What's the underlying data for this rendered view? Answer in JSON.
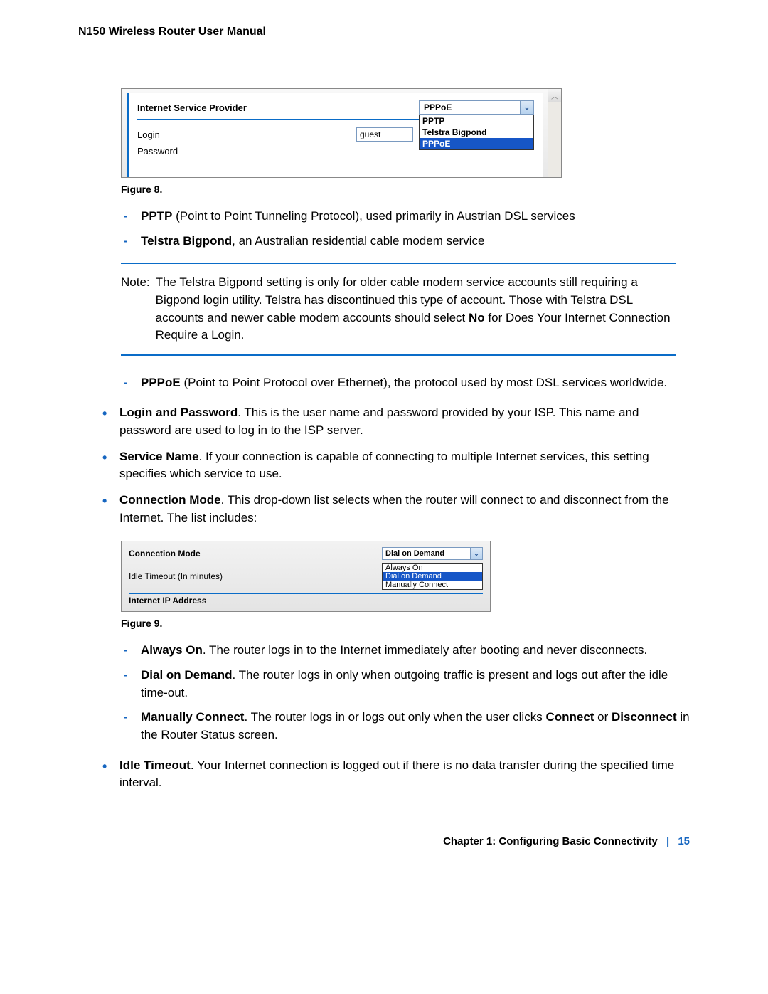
{
  "doc_title": "N150 Wireless Router User Manual",
  "figure8": {
    "isp_label": "Internet Service Provider",
    "login_label": "Login",
    "login_value": "guest",
    "password_label": "Password",
    "select_value": "PPPoE",
    "options": [
      "PPTP",
      "Telstra Bigpond",
      "PPPoE"
    ],
    "selected_index": 2,
    "caption": "Figure 8."
  },
  "list1": {
    "pptp_bold": "PPTP",
    "pptp_rest": " (Point to Point Tunneling Protocol), used primarily in Austrian DSL services",
    "telstra_bold": "Telstra Bigpond",
    "telstra_rest": ", an Australian residential cable modem service"
  },
  "note": {
    "label": "Note:",
    "body_a": "The Telstra Bigpond setting is only for older cable modem service accounts still requiring a Bigpond login utility. Telstra has discontinued this type of account. Those with Telstra DSL accounts and newer cable modem accounts should select ",
    "body_bold": "No",
    "body_b": " for Does Your Internet Connection Require a Login."
  },
  "list2": {
    "pppoe_bold": "PPPoE",
    "pppoe_rest": " (Point to Point Protocol over Ethernet), the protocol used by most DSL services worldwide."
  },
  "bullets1": {
    "b1_bold": "Login and Password",
    "b1_rest": ". This is the user name and password provided by your ISP. This name and password are used to log in to the ISP server.",
    "b2_bold": "Service Name",
    "b2_rest": ". If your connection is capable of connecting to multiple Internet services, this setting specifies which service to use.",
    "b3_bold": "Connection Mode",
    "b3_rest": ". This drop-down list selects when the router will connect to and disconnect from the Internet. The list includes:"
  },
  "figure9": {
    "conn_mode_label": "Connection Mode",
    "idle_label": "Idle Timeout (In minutes)",
    "ip_label": "Internet IP Address",
    "select_value": "Dial on Demand",
    "options": [
      "Always On",
      "Dial on Demand",
      "Manually Connect"
    ],
    "selected_index": 1,
    "caption": "Figure 9."
  },
  "list3": {
    "a_bold": "Always On",
    "a_rest": ". The router logs in to the Internet immediately after booting and never disconnects.",
    "b_bold": "Dial on Demand",
    "b_rest": ". The router logs in only when outgoing traffic is present and logs out after the idle time-out.",
    "c_bold": "Manually Connect",
    "c_rest_a": ". The router logs in or logs out only when the user clicks ",
    "c_connect": "Connect",
    "c_rest_b": " or ",
    "c_disconnect": "Disconnect",
    "c_rest_c": " in the Router Status screen."
  },
  "bullets2": {
    "b1_bold": "Idle Timeout",
    "b1_rest": ". Your Internet connection is logged out if there is no data transfer during the specified time interval."
  },
  "footer": {
    "chapter": "Chapter 1:  Configuring Basic Connectivity",
    "page": "15"
  }
}
